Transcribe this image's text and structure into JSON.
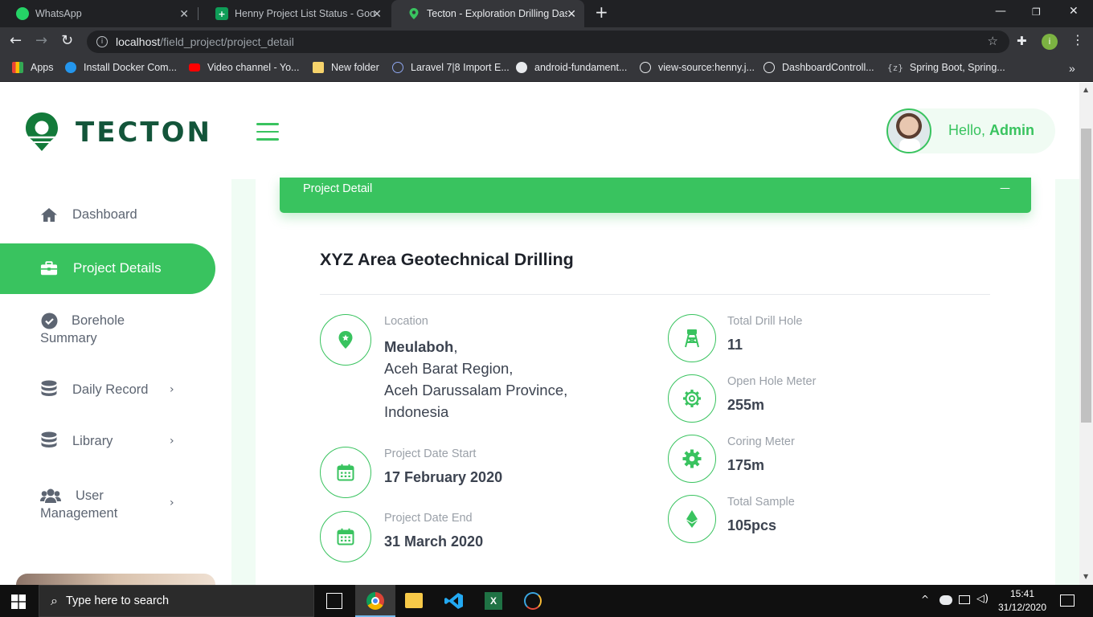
{
  "browser": {
    "tabs": [
      {
        "title": "WhatsApp",
        "icon": "whatsapp-icon",
        "color": "#25d366"
      },
      {
        "title": "Henny Project List Status - Googl",
        "icon": "sheets-icon",
        "color": "#0f9d58"
      },
      {
        "title": "Tecton - Exploration Drilling Dash",
        "icon": "tecton-icon",
        "color": "#39c35f",
        "active": true
      }
    ],
    "new_tab": "+",
    "url_host": "localhost",
    "url_path": "/field_project/project_detail",
    "bookmarks": [
      {
        "label": "Apps",
        "icon": "apps-grid-icon",
        "color": "#ea4335"
      },
      {
        "label": "Install Docker Com...",
        "icon": "docker-icon",
        "color": "#2496ed"
      },
      {
        "label": "Video channel - Yo...",
        "icon": "youtube-icon",
        "color": "#ff0000"
      },
      {
        "label": "New folder",
        "icon": "folder-icon",
        "color": "#f6d36b"
      },
      {
        "label": "Laravel 7|8 Import E...",
        "icon": "laravel-icon",
        "color": "#8fa7f0"
      },
      {
        "label": "android-fundament...",
        "icon": "github-icon",
        "color": "#e8eaed"
      },
      {
        "label": "view-source:henny.j...",
        "icon": "globe-icon",
        "color": "#e8eaed"
      },
      {
        "label": "DashboardControll...",
        "icon": "globe-icon",
        "color": "#e8eaed"
      },
      {
        "label": "Spring Boot, Spring...",
        "icon": "zotero-icon",
        "color": "#bdc1c6"
      }
    ]
  },
  "app": {
    "brand": "TECTON",
    "brand_color": "#39c35f",
    "greeting_prefix": "Hello, ",
    "greeting_name": "Admin"
  },
  "sidebar": {
    "items": [
      {
        "label": "Dashboard",
        "icon": "home-icon"
      },
      {
        "label": "Project Details",
        "icon": "briefcase-icon",
        "active": true
      },
      {
        "label_line1": "Borehole",
        "label_line2": "Summary",
        "icon": "check-circle-icon"
      },
      {
        "label": "Daily Record",
        "icon": "database-icon",
        "has_submenu": true
      },
      {
        "label": "Library",
        "icon": "database-icon",
        "has_submenu": true
      },
      {
        "label_line1": "User",
        "label_line2": "Management",
        "icon": "users-icon",
        "has_submenu": true
      }
    ]
  },
  "panel": {
    "header": "Project Detail",
    "collapse": "—",
    "project_title": "XYZ Area Geotechnical Drilling",
    "location_label": "Location",
    "location_city": "Meulaboh",
    "location_comma": ",",
    "location_lines": [
      "Aceh Barat Region,",
      "Aceh Darussalam Province,",
      "Indonesia"
    ],
    "date_start_label": "Project Date Start",
    "date_start": "17 February 2020",
    "date_end_label": "Project Date End",
    "date_end": "31 March 2020",
    "stats": [
      {
        "label": "Total Drill Hole",
        "value": "11",
        "icon": "drill-tower-icon"
      },
      {
        "label": "Open Hole Meter",
        "value": "255m",
        "icon": "gear-icon"
      },
      {
        "label": "Coring Meter",
        "value": "175m",
        "icon": "cog-solid-icon"
      },
      {
        "label": "Total Sample",
        "value": "105pcs",
        "icon": "ethereum-icon"
      }
    ]
  },
  "taskbar": {
    "search_placeholder": "Type here to search",
    "time": "15:41",
    "date": "31/12/2020"
  }
}
